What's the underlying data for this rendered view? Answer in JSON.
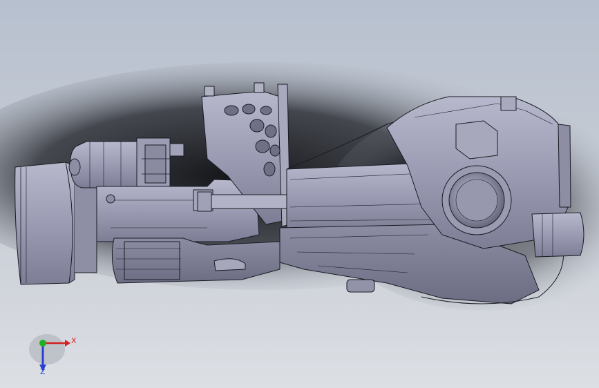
{
  "viewport": {
    "background_top": "#b7c0cf",
    "background_bottom": "#dcdfe4",
    "model_color": "#9a9bb2",
    "edge_color": "#1a1a24"
  },
  "triad": {
    "x_label": "X",
    "z_label": "Z",
    "x_color": "#d22222",
    "y_color": "#22b022",
    "z_color": "#2a3fd0"
  }
}
